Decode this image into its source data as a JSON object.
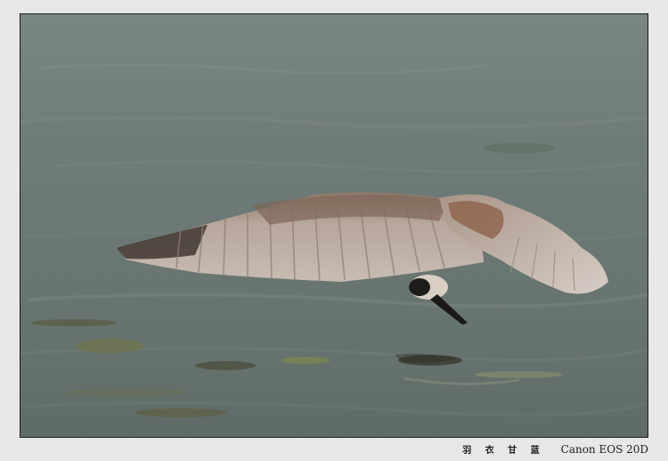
{
  "caption": {
    "author": "羽 衣 甘 蓝",
    "camera": "Canon EOS 20D"
  },
  "photo": {
    "subject": "bird-in-flight",
    "colors": {
      "water": "#6f7c79",
      "wing": "#b9aaa0",
      "frame": "#1c1c1c",
      "background": "#e6e7e6"
    }
  }
}
